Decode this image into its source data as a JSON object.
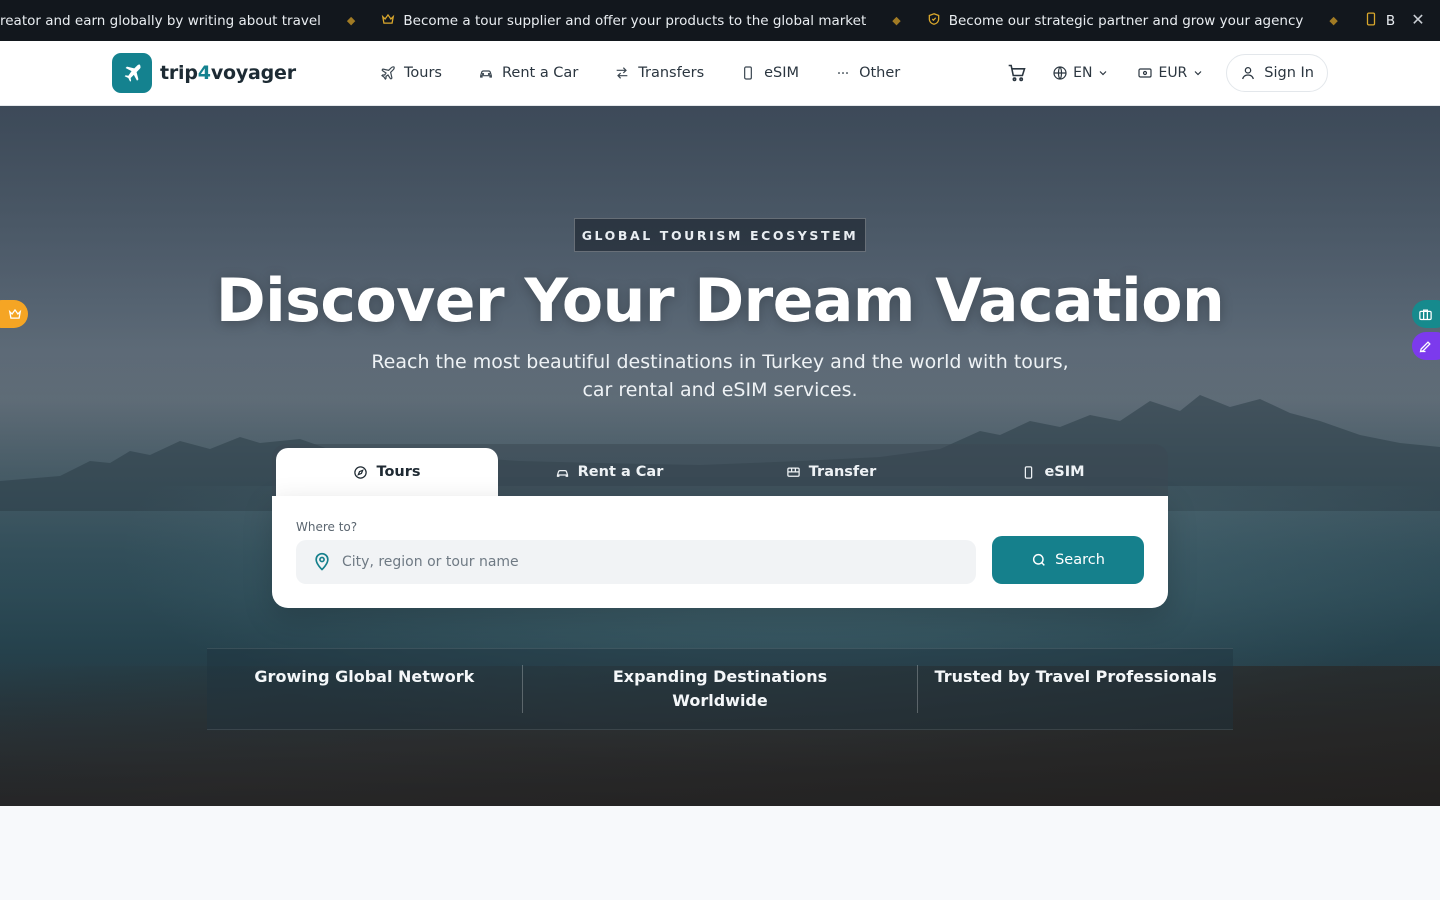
{
  "ticker": {
    "items": [
      {
        "icon": "pen-icon",
        "text": "reator and earn globally by writing about travel"
      },
      {
        "icon": "crown-icon",
        "text": "Become a tour supplier and offer your products to the global market"
      },
      {
        "icon": "shield-icon",
        "text": "Become our strategic partner and grow your agency"
      },
      {
        "icon": "phone-icon",
        "text": "B"
      }
    ],
    "close_icon": "close-icon"
  },
  "brand": {
    "name_part1": "trip",
    "name_accent": "4",
    "name_part2": "voyager",
    "color": "#14828f"
  },
  "nav": {
    "items": [
      {
        "label": "Tours",
        "icon": "plane-icon"
      },
      {
        "label": "Rent a Car",
        "icon": "car-icon"
      },
      {
        "label": "Transfers",
        "icon": "arrows-icon"
      },
      {
        "label": "eSIM",
        "icon": "phone-icon"
      },
      {
        "label": "Other",
        "icon": "dots-icon"
      }
    ],
    "cart_icon": "cart-icon",
    "language": "EN",
    "currency": "EUR",
    "signin_label": "Sign In"
  },
  "hero": {
    "badge": "GLOBAL TOURISM ECOSYSTEM",
    "title": "Discover Your Dream Vacation",
    "subtitle": "Reach the most beautiful destinations in Turkey and the world with tours, car rental and eSIM services."
  },
  "search": {
    "tabs": [
      {
        "label": "Tours",
        "icon": "compass-icon",
        "active": true
      },
      {
        "label": "Rent a Car",
        "icon": "car-icon",
        "active": false
      },
      {
        "label": "Transfer",
        "icon": "bus-icon",
        "active": false
      },
      {
        "label": "eSIM",
        "icon": "phone-icon",
        "active": false
      }
    ],
    "field_label": "Where to?",
    "placeholder": "City, region or tour name",
    "button_label": "Search"
  },
  "stats": [
    "Growing Global Network",
    "Expanding Destinations Worldwide",
    "Trusted by Travel Professionals"
  ],
  "colors": {
    "accent": "#15808c",
    "ticker_bg": "#12171d",
    "ticker_icon": "#d9a72c",
    "float_orange": "#f5a524",
    "float_teal": "#168a8d",
    "float_purple": "#7c3aed"
  }
}
